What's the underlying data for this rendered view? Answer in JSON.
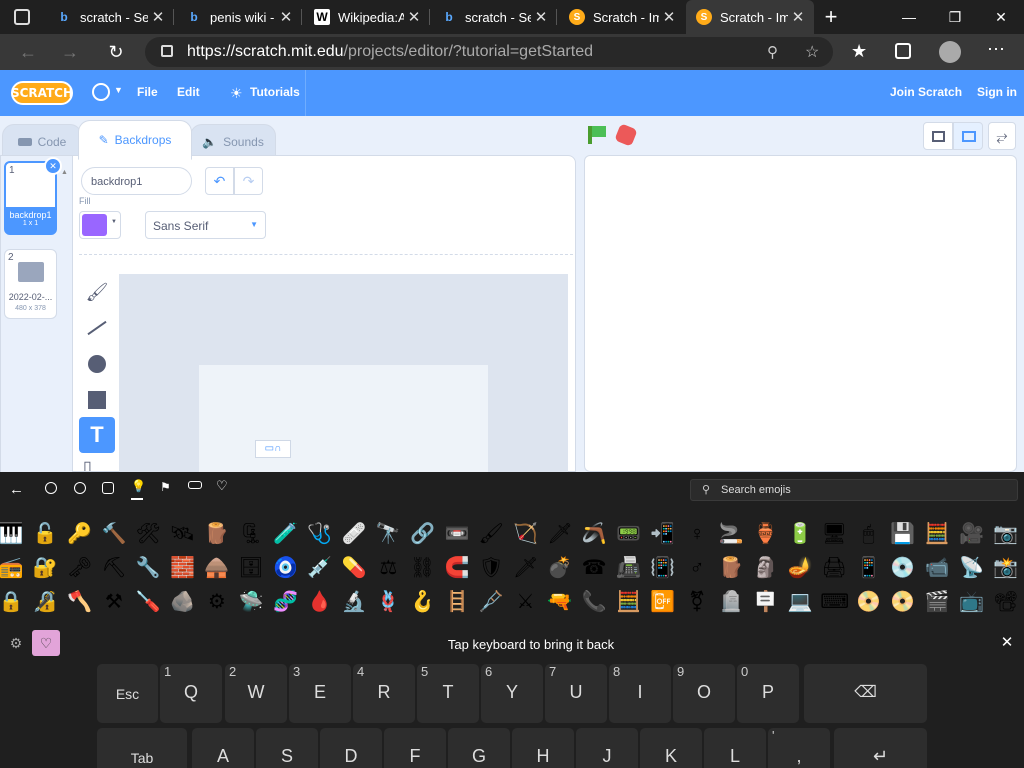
{
  "browser": {
    "tabs": [
      {
        "favicon": "bing-icon",
        "title": "scratch - Se",
        "active": false
      },
      {
        "favicon": "bing-icon",
        "title": "penis wiki -",
        "active": false
      },
      {
        "favicon": "wikipedia-icon",
        "title": "Wikipedia:A",
        "active": false
      },
      {
        "favicon": "bing-icon",
        "title": "scratch - Se",
        "active": false
      },
      {
        "favicon": "scratch-icon",
        "title": "Scratch - Im",
        "active": false
      },
      {
        "favicon": "scratch-icon",
        "title": "Scratch - Im",
        "active": true
      }
    ],
    "new_tab": "+",
    "url_host": "https://scratch.mit.edu",
    "url_path": "/projects/editor/?tutorial=getStarted"
  },
  "menu": {
    "logo": "SCRATCH",
    "file": "File",
    "edit": "Edit",
    "tutorials": "Tutorials",
    "join": "Join Scratch",
    "signin": "Sign in"
  },
  "editor": {
    "tabs": {
      "code": "Code",
      "backdrops": "Backdrops",
      "sounds": "Sounds"
    },
    "backdrops": [
      {
        "num": "1",
        "name": "backdrop1",
        "size": "1 x 1"
      },
      {
        "num": "2",
        "name": "2022-02-...",
        "size": "480 x 378"
      }
    ],
    "costume_name": "backdrop1",
    "fill_label": "Fill",
    "fill_color": "#9966ff",
    "font": "Sans Serif",
    "accent": "#4c97ff"
  },
  "keyboard": {
    "search_placeholder": "Search emojis",
    "hint": "Tap keyboard to bring it back",
    "row1": [
      {
        "num": "",
        "label": "Esc"
      },
      {
        "num": "1",
        "label": "Q"
      },
      {
        "num": "2",
        "label": "W"
      },
      {
        "num": "3",
        "label": "E"
      },
      {
        "num": "4",
        "label": "R"
      },
      {
        "num": "5",
        "label": "T"
      },
      {
        "num": "6",
        "label": "Y"
      },
      {
        "num": "7",
        "label": "U"
      },
      {
        "num": "8",
        "label": "I"
      },
      {
        "num": "9",
        "label": "O"
      },
      {
        "num": "0",
        "label": "P"
      }
    ],
    "row2": [
      {
        "num": "",
        "label": "Tab"
      },
      {
        "num": "",
        "label": "A"
      },
      {
        "num": "",
        "label": "S"
      },
      {
        "num": "",
        "label": "D"
      },
      {
        "num": "",
        "label": "F"
      },
      {
        "num": "",
        "label": "G"
      },
      {
        "num": "",
        "label": "H"
      },
      {
        "num": "",
        "label": "J"
      },
      {
        "num": "",
        "label": "K"
      },
      {
        "num": "",
        "label": "L"
      },
      {
        "num": "'",
        "label": ","
      }
    ],
    "emoji_rows": [
      [
        "🎹",
        "🔓",
        "🔑",
        "🔨",
        "🛠",
        "🛰",
        "🪵",
        "🗜",
        "🧪",
        "🩺",
        "🩹",
        "🔭",
        "🔗",
        "📼",
        "🖌",
        "🏹",
        "🗡",
        "🪃",
        "📟",
        "📲",
        "♀",
        "🚬",
        "🏺",
        "🔋",
        "🖥",
        "🖱",
        "💾",
        "🧮",
        "🎥",
        "📷"
      ],
      [
        "📻",
        "🔐",
        "🗝",
        "⛏",
        "🔧",
        "🧱",
        "🛖",
        "🗄",
        "🧿",
        "💉",
        "💊",
        "⚖",
        "⛓",
        "🧲",
        "🛡",
        "🗡",
        "💣",
        "☎",
        "📠",
        "📳",
        "♂",
        "🪵",
        "🗿",
        "🪔",
        "🖨",
        "📱",
        "💿",
        "📹",
        "📡",
        "📸"
      ],
      [
        "🔒",
        "🔏",
        "🪓",
        "⚒",
        "🪛",
        "🪨",
        "⚙",
        "🛸",
        "🧬",
        "🩸",
        "🔬",
        "🪢",
        "🪝",
        "🪜",
        "🩼",
        "⚔",
        "🔫",
        "📞",
        "🧮",
        "📴",
        "⚧",
        "🪦",
        "🪧",
        "💻",
        "⌨",
        "📀",
        "📀",
        "🎬",
        "📺",
        "📽"
      ]
    ]
  }
}
